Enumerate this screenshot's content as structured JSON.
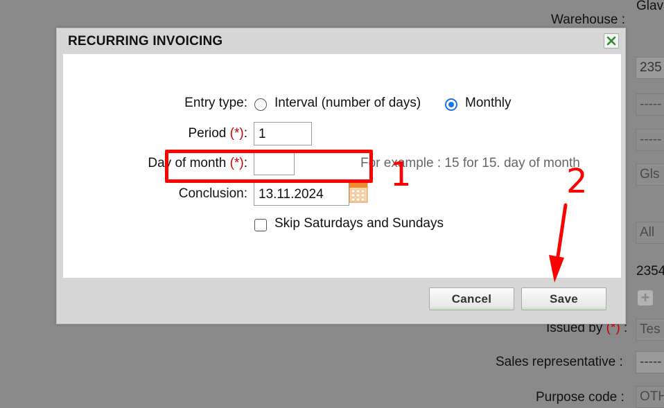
{
  "background": {
    "warehouse_label": "Warehouse :",
    "warehouse_value": "Glav",
    "field_1_value": "235",
    "field_2_value": "-----",
    "field_3_value": "-----",
    "field_4_value": "Gls",
    "field_5_value": "All",
    "number_value": "2354",
    "issued_by_label": "Issued by",
    "issued_by_required": "(*)",
    "issued_by_colon": ":",
    "issued_by_value": "Tes",
    "sales_rep_label": "Sales representative :",
    "sales_rep_value": "-----",
    "purpose_code_label": "Purpose code :",
    "purpose_code_value": "OTH"
  },
  "dialog": {
    "title": "RECURRING INVOICING",
    "entry_type_label": "Entry type:",
    "entry_type_options": [
      {
        "label": "Interval (number of days)",
        "checked": false
      },
      {
        "label": "Monthly",
        "checked": true
      }
    ],
    "period_label": "Period",
    "period_required": "(*)",
    "period_colon": ":",
    "period_value": "1",
    "day_of_month_label": "Day of month",
    "day_of_month_required": "(*)",
    "day_of_month_colon": ":",
    "day_of_month_value": "",
    "day_of_month_hint": "For example : 15 for 15. day of month",
    "conclusion_label": "Conclusion:",
    "conclusion_value": "13.11.2024",
    "skip_weekends_label": "Skip Saturdays and Sundays",
    "skip_weekends_checked": false,
    "cancel_label": "Cancel",
    "save_label": "Save"
  },
  "annotations": {
    "step_1": "1",
    "step_2": "2",
    "color": "#ff0000"
  },
  "colors": {
    "accent": "#1a73e8",
    "required": "#cc0000",
    "overlay": "#8a8a8a"
  }
}
